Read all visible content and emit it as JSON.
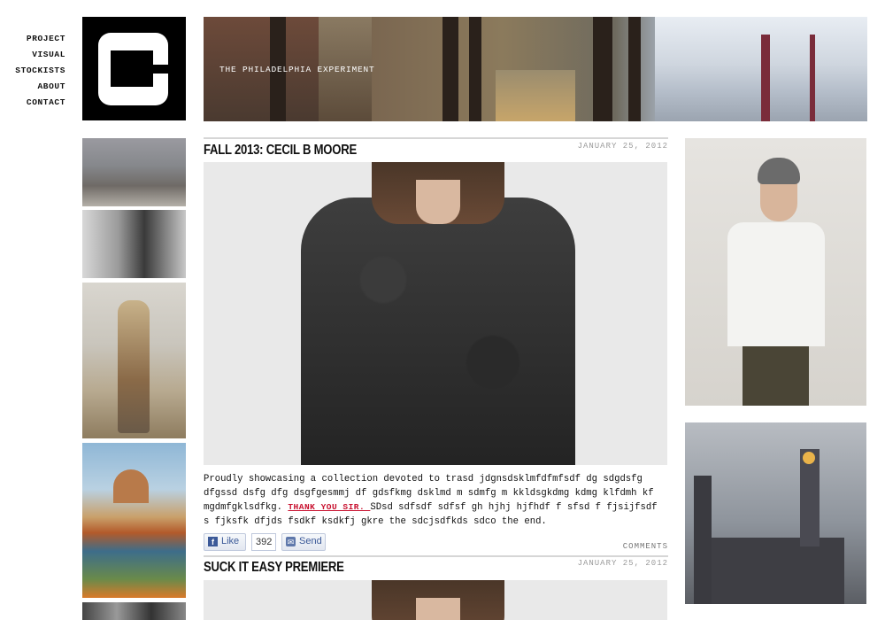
{
  "nav": {
    "items": [
      "PROJECT",
      "VISUAL",
      "STOCKISTS",
      "ABOUT",
      "CONTACT"
    ]
  },
  "banner": {
    "caption": "THE PHILADELPHIA EXPERIMENT"
  },
  "posts": [
    {
      "title": "FALL 2013: CECIL B MOORE",
      "date": "JANUARY 25, 2012",
      "body_before": "Proudly showcasing a collection devoted to trasd jdgnsdsklmfdfmfsdf dg sdgdsfg dfgssd dsfg dfg dsgfgesmmj df gdsfkmg dsklmd m sdmfg m kkldsgkdmg kdmg klfdmh kf mgdmfgklsdfkg. ",
      "link": "THANK YOU SIR. ",
      "body_after": "SDsd sdfsdf sdfsf gh hjhj hjfhdf f sfsd f fjsijfsdf s fjksfk dfjds fsdkf ksdkfj gkre the sdcjsdfkds sdco the end.",
      "like_label": "Like",
      "like_count": "392",
      "send_label": "Send",
      "comments_label": "COMMENTS"
    },
    {
      "title": "SUCK IT EASY PREMIERE",
      "date": "JANUARY 25, 2012"
    }
  ]
}
